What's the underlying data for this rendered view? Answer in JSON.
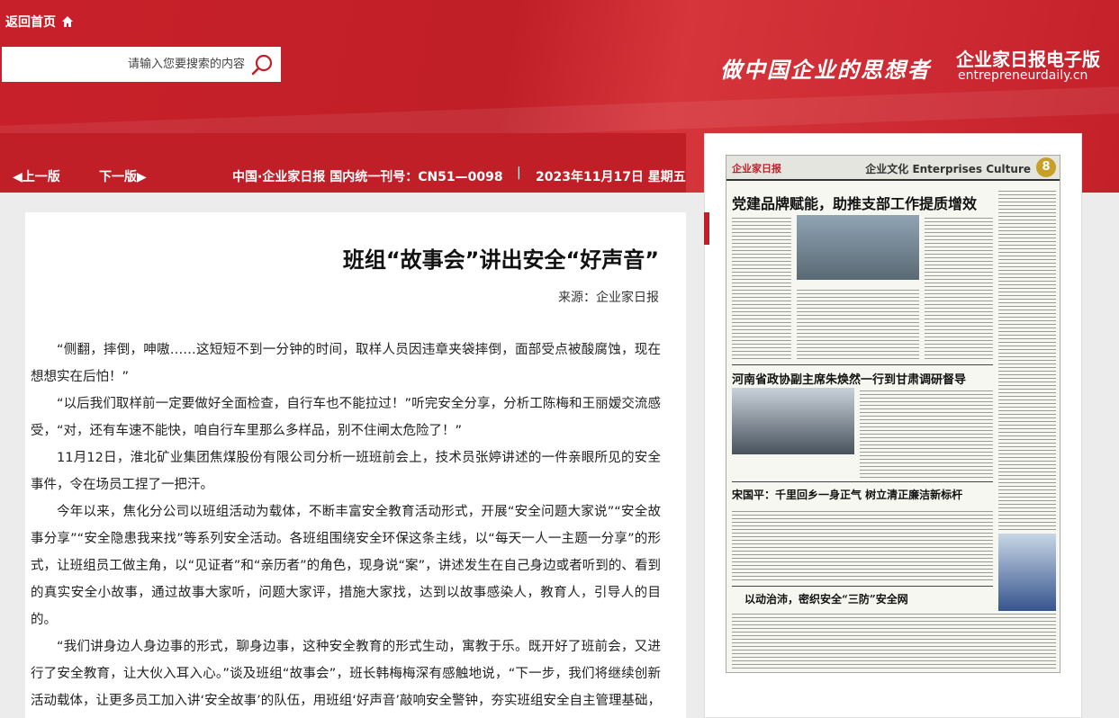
{
  "header": {
    "home_label": "返回首页",
    "search_placeholder": "请输入您要搜索的内容",
    "slogan": "做中国企业的思想者",
    "brand_title": "企业家日报电子版",
    "brand_domain": "entrepreneurdaily.cn"
  },
  "issue_bar": {
    "prev_label": "上一版",
    "next_label": "下一版",
    "issue_info": "中国·企业家日报  国内统一刊号：CN51—0098",
    "issue_date": "2023年11月17日 星期五"
  },
  "article": {
    "title": "班组“故事会”讲出安全“好声音”",
    "source": "来源：企业家日报",
    "paragraphs": [
      "“侧翻，摔倒，呻嗷……这短短不到一分钟的时间，取样人员因违章夹袋摔倒，面部受点被酸腐蚀，现在想想实在后怕！”",
      "“以后我们取样前一定要做好全面检查，自行车也不能拉过！”听完安全分享，分析工陈梅和王丽嫒交流感受，“对，还有车速不能快，咱自行车里那么多样品，别不住闸太危险了！”",
      "11月12日，淮北矿业集团焦煤股份有限公司分析一班班前会上，技术员张婷讲述的一件亲眼所见的安全事件，令在场员工捏了一把汗。",
      "今年以来，焦化分公司以班组活动为载体，不断丰富安全教育活动形式，开展“安全问题大家说”“安全故事分享”“安全隐患我来找”等系列安全活动。各班组围绕安全环保这条主线，以“每天一人一主题一分享”的形式，让班组员工做主角，以“见证者”和“亲历者”的角色，现身说“案”，讲述发生在自己身边或者听到的、看到的真实安全小故事，通过故事大家听，问题大家评，措施大家找，达到以故事感染人，教育人，引导人的目的。",
      "“我们讲身边人身边事的形式，聊身边事，这种安全教育的形式生动，寓教于乐。既开好了班前会，又进行了安全教育，让大伙入耳入心。”谈及班组“故事会”，班长韩梅梅深有感触地说，“下一步，我们将继续创新活动载体，让更多员工加入讲‘安全故事’的队伍，用班组‘好声音’敲响安全警钟，夯实班组安全自主管理基础，努力创建"
    ]
  },
  "paper": {
    "page_number": "8",
    "section": "企业文化 Enterprises Culture",
    "masthead": "企业家日报",
    "headline_1": "党建品牌赋能，助推支部工作提质增效",
    "headline_2": "河南省政协副主席朱焕然一行到甘肃调研督导",
    "headline_3": "宋国平：千里回乡一身正气  树立清正廉洁新标杆",
    "headline_4": "以动治沛，密织安全“三防”安全网"
  }
}
